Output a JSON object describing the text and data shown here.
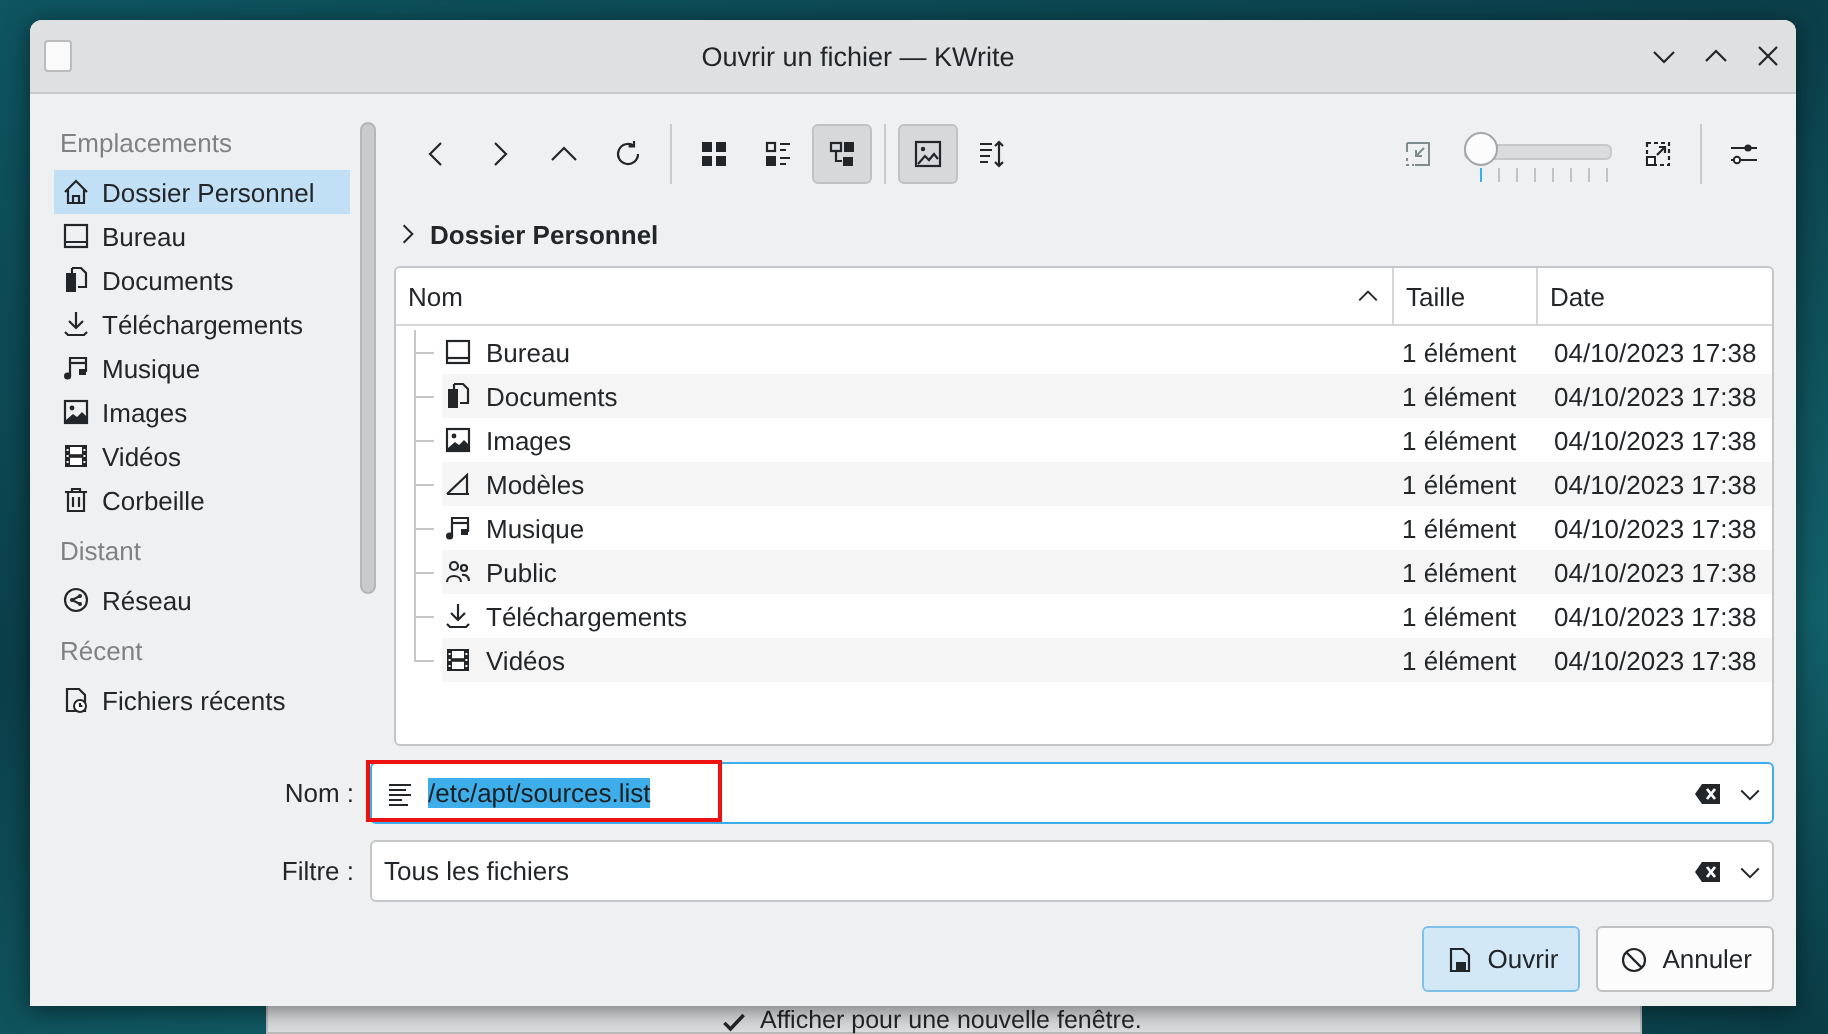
{
  "window": {
    "title": "Ouvrir un fichier — KWrite"
  },
  "sidebar": {
    "sections": [
      {
        "heading": "Emplacements",
        "items": [
          {
            "label": "Dossier Personnel",
            "kind": "home",
            "selected": true
          },
          {
            "label": "Bureau",
            "kind": "desktop",
            "selected": false
          },
          {
            "label": "Documents",
            "kind": "documents",
            "selected": false
          },
          {
            "label": "Téléchargements",
            "kind": "download",
            "selected": false
          },
          {
            "label": "Musique",
            "kind": "music",
            "selected": false
          },
          {
            "label": "Images",
            "kind": "images",
            "selected": false
          },
          {
            "label": "Vidéos",
            "kind": "videos",
            "selected": false
          },
          {
            "label": "Corbeille",
            "kind": "trash",
            "selected": false
          }
        ]
      },
      {
        "heading": "Distant",
        "items": [
          {
            "label": "Réseau",
            "kind": "network",
            "selected": false
          }
        ]
      },
      {
        "heading": "Récent",
        "items": [
          {
            "label": "Fichiers récents",
            "kind": "recent",
            "selected": false
          }
        ]
      }
    ]
  },
  "toolbar": {
    "view_modes": [
      {
        "kind": "icons",
        "selected": false
      },
      {
        "kind": "compact",
        "selected": false
      },
      {
        "kind": "tree",
        "selected": true
      }
    ],
    "preview": {
      "on": true
    },
    "zoom": {
      "level": 0
    }
  },
  "breadcrumb": {
    "label": "Dossier Personnel"
  },
  "table": {
    "columns": [
      {
        "label": "Nom",
        "sorted": true
      },
      {
        "label": "Taille",
        "sorted": false
      },
      {
        "label": "Date",
        "sorted": false
      }
    ],
    "rows": [
      {
        "name": "Bureau",
        "kind": "desktop",
        "size": "1 élément",
        "date": "04/10/2023 17:38"
      },
      {
        "name": "Documents",
        "kind": "documents",
        "size": "1 élément",
        "date": "04/10/2023 17:38"
      },
      {
        "name": "Images",
        "kind": "images",
        "size": "1 élément",
        "date": "04/10/2023 17:38"
      },
      {
        "name": "Modèles",
        "kind": "templates",
        "size": "1 élément",
        "date": "04/10/2023 17:38"
      },
      {
        "name": "Musique",
        "kind": "music",
        "size": "1 élément",
        "date": "04/10/2023 17:38"
      },
      {
        "name": "Public",
        "kind": "public",
        "size": "1 élément",
        "date": "04/10/2023 17:38"
      },
      {
        "name": "Téléchargements",
        "kind": "download",
        "size": "1 élément",
        "date": "04/10/2023 17:38"
      },
      {
        "name": "Vidéos",
        "kind": "videos",
        "size": "1 élément",
        "date": "04/10/2023 17:38"
      }
    ]
  },
  "name_field": {
    "label": "Nom :",
    "value": "/etc/apt/sources.list",
    "text_selected": true,
    "highlighted": true
  },
  "filter_field": {
    "label": "Filtre :",
    "value": "Tous les fichiers"
  },
  "buttons": [
    {
      "label": "Ouvrir",
      "kind": "open",
      "default": true
    },
    {
      "label": "Annuler",
      "kind": "cancel",
      "default": false
    }
  ],
  "background_window": {
    "checkbox": {
      "label": "Afficher pour une nouvelle fenêtre.",
      "checked": true
    }
  }
}
